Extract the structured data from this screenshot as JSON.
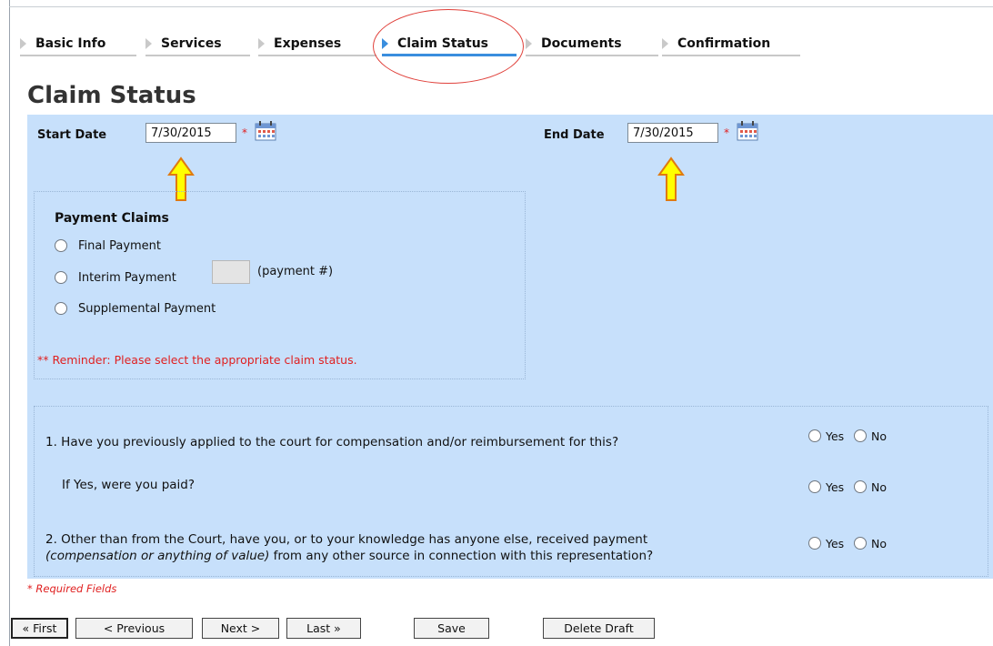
{
  "tabs": [
    {
      "label": "Basic Info"
    },
    {
      "label": "Services"
    },
    {
      "label": "Expenses"
    },
    {
      "label": "Claim Status"
    },
    {
      "label": "Documents"
    },
    {
      "label": "Confirmation"
    }
  ],
  "active_tab": "Claim Status",
  "page_title": "Claim Status",
  "dates": {
    "start_label": "Start Date",
    "start_value": "7/30/2015",
    "end_label": "End Date",
    "end_value": "7/30/2015",
    "required_marker": "*"
  },
  "payment_claims": {
    "title": "Payment Claims",
    "options": [
      {
        "label": "Final Payment"
      },
      {
        "label": "Interim Payment"
      },
      {
        "label": "Supplemental Payment"
      }
    ],
    "payment_num_label": "(payment #)",
    "reminder": "** Reminder: Please select the appropriate claim status."
  },
  "questions": {
    "q1": "1. Have you previously applied to the court for compensation and/or reimbursement for this?",
    "q1b": "If Yes, were you paid?",
    "q2_line1": "2. Other than from the Court, have you, or to your knowledge has anyone else, received payment",
    "q2_italic": "(compensation or anything of value)",
    "q2_line2_rest": " from any other source in connection with this representation?",
    "yes_label": "Yes",
    "no_label": "No"
  },
  "required_note": "* Required Fields",
  "buttons": {
    "first": "« First",
    "previous": "< Previous",
    "next": "Next >",
    "last": "Last »",
    "save": "Save",
    "delete_draft": "Delete Draft"
  },
  "colors": {
    "panel_bg": "#c7e0fb",
    "active_tab_accent": "#3a8ede",
    "annotation_ellipse": "#e0413b",
    "annotation_arrow": "#ffff00",
    "required": "#e02020"
  },
  "icons": {
    "calendar": "calendar-icon",
    "annotation_arrow": "up-arrow-icon",
    "tab_arrow": "chevron-right-icon"
  }
}
